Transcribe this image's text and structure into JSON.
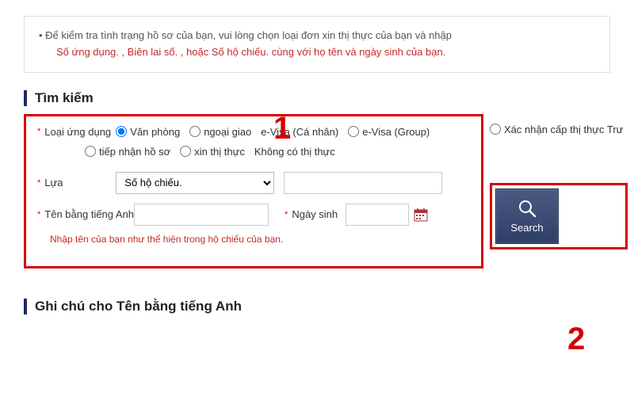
{
  "info": {
    "line1": "• Để kiểm tra tình trạng hồ sơ của bạn, vui lòng chọn loại đơn xin thị thực của bạn và nhập",
    "line2": "Số ứng dụng. , Biên lai số. , hoặc Số hộ chiếu. cùng với họ tên và ngày sinh của bạn."
  },
  "section_title": "Tìm kiếm",
  "annotations": {
    "num1": "1",
    "num2": "2"
  },
  "form": {
    "app_type_label": "Loại ứng dụng",
    "radios_row1": [
      {
        "label": "Văn phòng",
        "checked": true
      },
      {
        "label": "ngoại giao",
        "checked": false
      },
      {
        "label": "e-Visa (Cá nhân)",
        "checked": false,
        "noinput": true
      },
      {
        "label": "e-Visa (Group)",
        "checked": false
      }
    ],
    "radios_row2": [
      {
        "label": "tiếp nhận hồ sơ",
        "checked": false
      },
      {
        "label": "xin thị thực",
        "checked": false
      },
      {
        "label": "Không có thị thực",
        "checked": false,
        "noinput": true
      }
    ],
    "outside_radio_label": "Xác nhận cấp thị thực Trư",
    "select_label": "Lựa",
    "select_value": "Số hộ chiếu.",
    "name_label": "Tên bằng tiếng Anh",
    "dob_label": "Ngày sinh",
    "name_hint": "Nhập tên của bạn như thể hiện trong hộ chiếu của bạn."
  },
  "search_btn_label": "Search",
  "note_section_title": "Ghi chú cho Tên bằng tiếng Anh"
}
